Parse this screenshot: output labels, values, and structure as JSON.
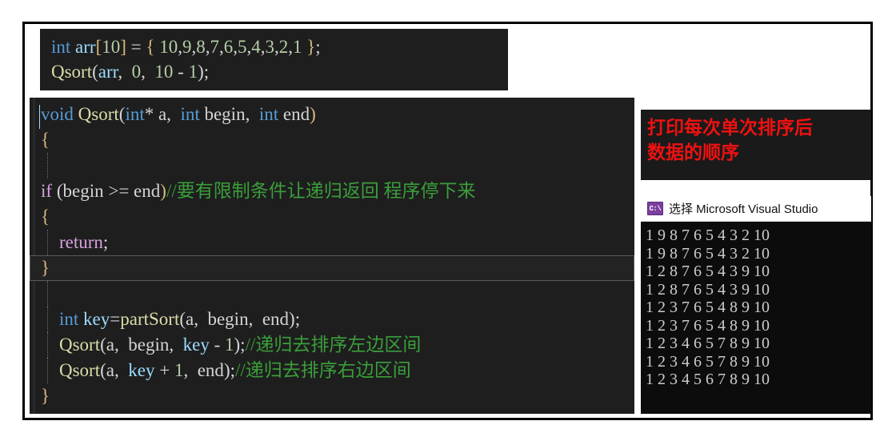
{
  "call_snippet": {
    "name": "qsort-call-snippet",
    "lines": [
      [
        {
          "t": "int ",
          "c": "kw"
        },
        {
          "t": "arr",
          "c": "ident"
        },
        {
          "t": "[",
          "c": "brace"
        },
        {
          "t": "10",
          "c": "num"
        },
        {
          "t": "]",
          "c": "brace"
        },
        {
          "t": " = ",
          "c": "punct"
        },
        {
          "t": "{",
          "c": "brace"
        },
        {
          "t": " ",
          "c": "punct"
        },
        {
          "t": "10",
          "c": "num"
        },
        {
          "t": ",",
          "c": "punct"
        },
        {
          "t": "9",
          "c": "num"
        },
        {
          "t": ",",
          "c": "punct"
        },
        {
          "t": "8",
          "c": "num"
        },
        {
          "t": ",",
          "c": "punct"
        },
        {
          "t": "7",
          "c": "num"
        },
        {
          "t": ",",
          "c": "punct"
        },
        {
          "t": "6",
          "c": "num"
        },
        {
          "t": ",",
          "c": "punct"
        },
        {
          "t": "5",
          "c": "num"
        },
        {
          "t": ",",
          "c": "punct"
        },
        {
          "t": "4",
          "c": "num"
        },
        {
          "t": ",",
          "c": "punct"
        },
        {
          "t": "3",
          "c": "num"
        },
        {
          "t": ",",
          "c": "punct"
        },
        {
          "t": "2",
          "c": "num"
        },
        {
          "t": ",",
          "c": "punct"
        },
        {
          "t": "1",
          "c": "num"
        },
        {
          "t": " ",
          "c": "punct"
        },
        {
          "t": "}",
          "c": "brace"
        },
        {
          "t": ";",
          "c": "punct"
        }
      ],
      [
        {
          "t": "Qsort",
          "c": "func"
        },
        {
          "t": "(",
          "c": "punct"
        },
        {
          "t": "arr",
          "c": "ident"
        },
        {
          "t": ",  ",
          "c": "punct"
        },
        {
          "t": "0",
          "c": "num"
        },
        {
          "t": ",  ",
          "c": "punct"
        },
        {
          "t": "10",
          "c": "num"
        },
        {
          "t": " - ",
          "c": "punct"
        },
        {
          "t": "1",
          "c": "num"
        },
        {
          "t": ");",
          "c": "punct"
        }
      ]
    ],
    "plain_text": [
      "int arr[10] = { 10,9,8,7,6,5,4,3,2,1 };",
      "Qsort(arr,  0,  10 - 1);"
    ]
  },
  "editor": {
    "name": "qsort-definition-editor",
    "current_line_index": 6,
    "lines": [
      {
        "indent_guide": false,
        "text": "void Qsort(int* a,  int begin,  int end)",
        "spans": [
          {
            "t": "void ",
            "c": "kw"
          },
          {
            "t": "Qsort",
            "c": "func"
          },
          {
            "t": "(",
            "c": "punct"
          },
          {
            "t": "int",
            "c": "kw"
          },
          {
            "t": "*",
            "c": "punct"
          },
          {
            "t": " a,  ",
            "c": "plain"
          },
          {
            "t": "int",
            "c": "kw"
          },
          {
            "t": " begin,  ",
            "c": "plain"
          },
          {
            "t": "int",
            "c": "kw"
          },
          {
            "t": " end",
            "c": "plain"
          },
          {
            "t": ")",
            "c": "brace"
          }
        ]
      },
      {
        "indent_guide": false,
        "text": "{",
        "spans": [
          {
            "t": "{",
            "c": "brace"
          }
        ]
      },
      {
        "indent_guide": true,
        "text": "",
        "spans": []
      },
      {
        "indent_guide": false,
        "text": "if (begin >= end)//要有限制条件让递归返回 程序停下来",
        "spans": [
          {
            "t": "if",
            "c": "kw-ctl"
          },
          {
            "t": " (",
            "c": "punct"
          },
          {
            "t": "begin",
            "c": "plain"
          },
          {
            "t": " >= ",
            "c": "punct"
          },
          {
            "t": "end",
            "c": "plain"
          },
          {
            "t": ")",
            "c": "brace"
          },
          {
            "t": "//要有限制条件让递归返回 程序停下来",
            "c": "comment"
          }
        ]
      },
      {
        "indent_guide": false,
        "text": "{",
        "spans": [
          {
            "t": "{",
            "c": "brace"
          }
        ]
      },
      {
        "indent_guide": true,
        "text": "    return;",
        "spans": [
          {
            "t": "    ",
            "c": "plain"
          },
          {
            "t": "return",
            "c": "kw-ctl"
          },
          {
            "t": ";",
            "c": "punct"
          }
        ]
      },
      {
        "indent_guide": false,
        "text": "}",
        "spans": [
          {
            "t": "}",
            "c": "brace"
          }
        ]
      },
      {
        "indent_guide": true,
        "text": "",
        "spans": []
      },
      {
        "indent_guide": true,
        "text": "    int key=partSort(a,  begin,  end);",
        "spans": [
          {
            "t": "    ",
            "c": "plain"
          },
          {
            "t": "int",
            "c": "kw"
          },
          {
            "t": " ",
            "c": "plain"
          },
          {
            "t": "key",
            "c": "ident"
          },
          {
            "t": "=",
            "c": "punct"
          },
          {
            "t": "partSort",
            "c": "func"
          },
          {
            "t": "(",
            "c": "punct"
          },
          {
            "t": "a,  begin,  end",
            "c": "plain"
          },
          {
            "t": ");",
            "c": "punct"
          }
        ]
      },
      {
        "indent_guide": true,
        "text": "    Qsort(a,  begin,  key - 1);//递归去排序左边区间",
        "spans": [
          {
            "t": "    ",
            "c": "plain"
          },
          {
            "t": "Qsort",
            "c": "func"
          },
          {
            "t": "(",
            "c": "punct"
          },
          {
            "t": "a,  begin,  ",
            "c": "plain"
          },
          {
            "t": "key",
            "c": "ident"
          },
          {
            "t": " - ",
            "c": "punct"
          },
          {
            "t": "1",
            "c": "num"
          },
          {
            "t": ");",
            "c": "punct"
          },
          {
            "t": "//递归去排序左边区间",
            "c": "comment"
          }
        ]
      },
      {
        "indent_guide": true,
        "text": "    Qsort(a,  key + 1,  end);//递归去排序右边区间",
        "spans": [
          {
            "t": "    ",
            "c": "plain"
          },
          {
            "t": "Qsort",
            "c": "func"
          },
          {
            "t": "(",
            "c": "punct"
          },
          {
            "t": "a,  ",
            "c": "plain"
          },
          {
            "t": "key",
            "c": "ident"
          },
          {
            "t": " + ",
            "c": "punct"
          },
          {
            "t": "1",
            "c": "num"
          },
          {
            "t": ",  ",
            "c": "punct"
          },
          {
            "t": "end",
            "c": "plain"
          },
          {
            "t": ");",
            "c": "punct"
          },
          {
            "t": "//递归去排序右边区间",
            "c": "comment"
          }
        ]
      },
      {
        "indent_guide": false,
        "text": "}",
        "spans": [
          {
            "t": "}",
            "c": "brace"
          }
        ]
      }
    ]
  },
  "note_panel": {
    "name": "annotation-note",
    "color": "#ee1111",
    "lines": [
      "打印每次单次排序后",
      "数据的顺序"
    ]
  },
  "console": {
    "name": "visual-studio-console",
    "icon": "cmd-console-icon",
    "icon_glyph": "C:\\",
    "title": "选择 Microsoft Visual Studio",
    "background": "#0c0c0c",
    "output_lines": [
      "1 9 8 7 6 5 4 3 2 10",
      "1 9 8 7 6 5 4 3 2 10",
      "1 2 8 7 6 5 4 3 9 10",
      "1 2 8 7 6 5 4 3 9 10",
      "1 2 3 7 6 5 4 8 9 10",
      "1 2 3 7 6 5 4 8 9 10",
      "1 2 3 4 6 5 7 8 9 10",
      "1 2 3 4 6 5 7 8 9 10",
      "1 2 3 4 5 6 7 8 9 10"
    ]
  }
}
